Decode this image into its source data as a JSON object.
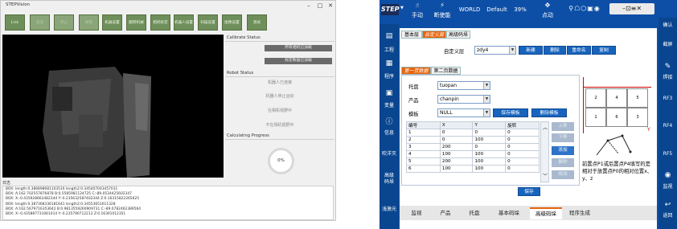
{
  "left": {
    "title": "STEPVision",
    "toolbar": [
      "Link",
      "启动",
      "停止",
      "帧管",
      "机器设置",
      "翻转机械",
      "相机标定",
      "机器人设置",
      "扫描设置",
      "图像设置",
      "测试"
    ],
    "calibrate": {
      "header": "Calibrate Status",
      "btn1": "所有相机已加载",
      "btn2": "标定数据已加载"
    },
    "robot": {
      "header": "Robot Status",
      "items": [
        "机器人已连接",
        "机器人停止运动",
        "在相机视野中",
        "不在相机视野中"
      ]
    },
    "progress": {
      "header": "Calculating Progress",
      "value": "0%"
    },
    "log": {
      "header": "日志",
      "lines": [
        "BOX: length:0.386898681103516 length2:0.345407043457031",
        "BOX: A:162.702557876878 B:0.5585981124725 C:-89.0534425602347",
        "BOX: X:-0.435928662482344 Y:-0.235632587402344 Z:0.16315822265625",
        "BOX: length:0.387368336181641 length2:0.34553651611328",
        "BOX: A:162.5679716353642 B:0.9813559260909731 C:-89.0782462389564",
        "BOX: X:-0.435887731061014 Y:-0.235790712213 Z:0.16301012351"
      ]
    }
  },
  "right": {
    "topbar": {
      "brand": "STEP",
      "hand": "手动",
      "power": "断使能",
      "world": "WORLD",
      "mode": "Default",
      "speed": "39%",
      "jog": "点动"
    },
    "sideL": [
      "工程",
      "程序",
      "变量",
      "信息",
      "吹洋灭",
      "高级\n码垛",
      "浅激光"
    ],
    "sideR": [
      "确认",
      "截屏",
      "焊接",
      "RF3",
      "RF4",
      "RF5",
      "监视",
      "返回"
    ],
    "toptabs": [
      "基本层",
      "自定义层",
      "高级码垛"
    ],
    "custom": {
      "label": "自定义层",
      "value": "zdy4",
      "buttons": [
        "新建",
        "删除",
        "重命名",
        "复制"
      ]
    },
    "datatabs": [
      "第一页数据",
      "第二页数据"
    ],
    "fields": [
      {
        "label": "托盘",
        "value": "tuopan"
      },
      {
        "label": "产品",
        "value": "chanpin"
      },
      {
        "label": "模板",
        "value": "NULL"
      }
    ],
    "tmplButtons": [
      "保存模板",
      "删除模板"
    ],
    "table": {
      "headers": [
        "编号",
        "X",
        "Y",
        "旋转"
      ],
      "rows": [
        [
          "1",
          "0",
          "0",
          "0"
        ],
        [
          "2",
          "0",
          "100",
          "0"
        ],
        [
          "3",
          "200",
          "0",
          "0"
        ],
        [
          "4",
          "100",
          "100",
          "0"
        ],
        [
          "5",
          "200",
          "100",
          "0"
        ],
        [
          "6",
          "100",
          "100",
          "0"
        ]
      ]
    },
    "sideButtons": [
      "上移",
      "下移",
      "添加",
      "删除",
      "修改"
    ],
    "save": "保存",
    "note": "前置点P1或后置点P4填写的是相对于放置点P0的相对位置x、y、z",
    "diagram": {
      "x": "X",
      "y": "Y",
      "cells": [
        "2",
        "4",
        "5",
        "1",
        "6",
        "3"
      ]
    },
    "bottomTabs": [
      "监视",
      "产品",
      "托盘",
      "基本码垛",
      "高级码垛",
      "程序生成"
    ],
    "activeBottom": "高级码垛",
    "colors": {
      "bg": "#0d4fa6",
      "accent": "#e8630a",
      "panel": "#ffffff"
    }
  }
}
